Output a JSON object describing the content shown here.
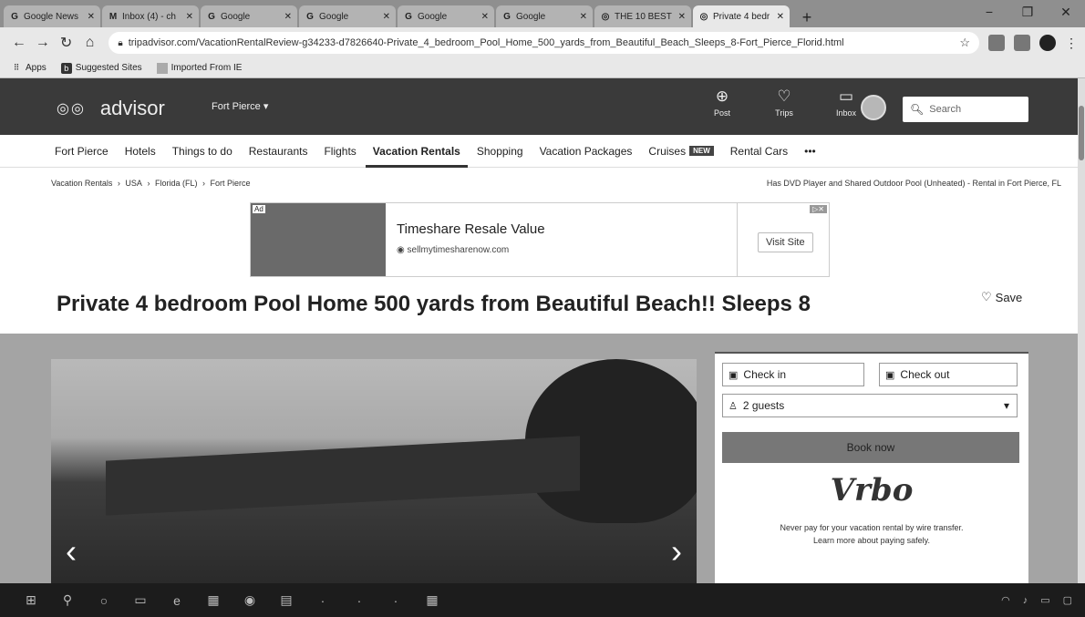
{
  "browser": {
    "tabs": [
      {
        "icon": "news-icon",
        "glyph": "G",
        "label": "Google News",
        "active": false
      },
      {
        "icon": "gmail-icon",
        "glyph": "M",
        "label": "Inbox (4) - ch",
        "active": false
      },
      {
        "icon": "google-icon",
        "glyph": "G",
        "label": "Google",
        "active": false
      },
      {
        "icon": "google-icon",
        "glyph": "G",
        "label": "Google",
        "active": false
      },
      {
        "icon": "google-icon",
        "glyph": "G",
        "label": "Google",
        "active": false
      },
      {
        "icon": "google-icon",
        "glyph": "G",
        "label": "Google",
        "active": false
      },
      {
        "icon": "tripadvisor-icon",
        "glyph": "◎",
        "label": "THE 10 BEST",
        "active": false
      },
      {
        "icon": "tripadvisor-icon",
        "glyph": "◎",
        "label": "Private 4 bedr",
        "active": true
      }
    ],
    "new_tab": "+",
    "url": "tripadvisor.com/VacationRentalReview-g34233-d7826640-Private_4_bedroom_Pool_Home_500_yards_from_Beautiful_Beach_Sleeps_8-Fort_Pierce_Florid.html",
    "bookmarks": {
      "apps": "Apps",
      "suggested": "Suggested Sites",
      "imported": "Imported From IE"
    }
  },
  "header": {
    "logo_text": "advisor",
    "location": "Fort Pierce ▾",
    "post": "Post",
    "trips": "Trips",
    "inbox": "Inbox",
    "search_placeholder": "Search"
  },
  "subnav": {
    "items": [
      "Fort Pierce",
      "Hotels",
      "Things to do",
      "Restaurants",
      "Flights",
      "Vacation Rentals",
      "Shopping",
      "Vacation Packages",
      "Cruises",
      "Rental Cars",
      "•••"
    ],
    "cruises_badge": "NEW"
  },
  "breadcrumbs": [
    "Vacation Rentals",
    "›",
    "USA",
    "›",
    "Florida (FL)",
    "›",
    "Fort Pierce"
  ],
  "right_note": "Has DVD Player and Shared Outdoor Pool (Unheated) - Rental in Fort Pierce, FL",
  "ad": {
    "tag": "Ad",
    "headline": "Timeshare Resale Value",
    "domain": "sellmytimesharenow.com",
    "cta": "Visit Site"
  },
  "listing": {
    "title": "Private 4 bedroom Pool Home 500 yards from Beautiful Beach!! Sleeps 8",
    "save": "Save"
  },
  "gallery": {
    "prev": "‹",
    "next": "›"
  },
  "booking": {
    "check_in": "Check in",
    "check_out": "Check out",
    "guests": "2 guests",
    "book_now": "Book now",
    "brand": "Vrbo",
    "note_line1": "Never pay for your vacation rental by wire transfer.",
    "note_line2": "Learn more about paying safely."
  }
}
